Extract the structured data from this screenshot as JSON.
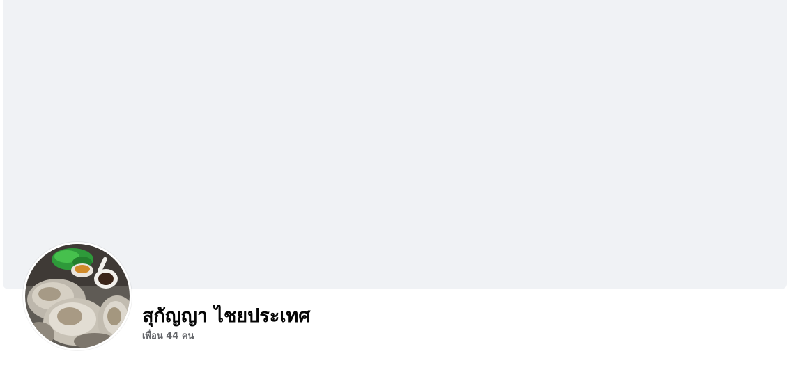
{
  "profile": {
    "name": "สุกัญญา ไชยประเทศ",
    "friends_label": "เพื่อน 44 คน"
  },
  "colors": {
    "cover_background": "#f0f2f5",
    "name_text": "#050505",
    "secondary_text": "#65676b",
    "divider": "#ced0d4"
  }
}
